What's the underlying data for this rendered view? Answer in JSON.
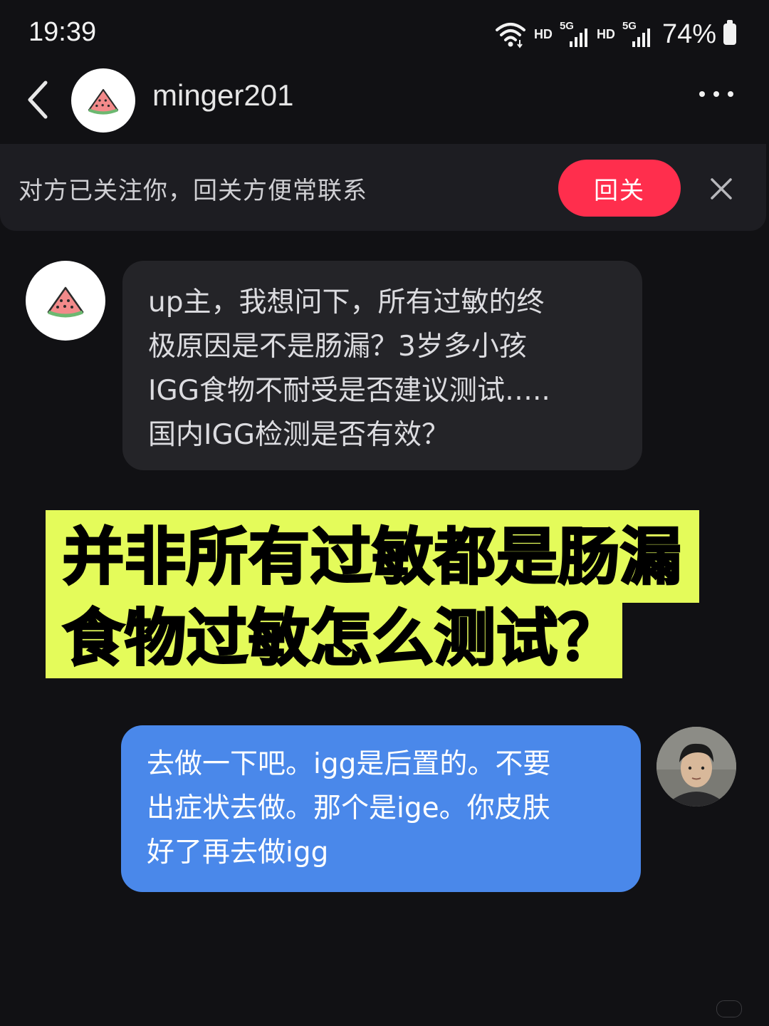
{
  "status_bar": {
    "time": "19:39",
    "network_1": "HD",
    "network_2": "HD",
    "signal_label": "5G",
    "battery": "74%"
  },
  "header": {
    "contact_name": "minger201",
    "back_icon": "chevron-left-icon",
    "more_icon": "more-horizontal-icon"
  },
  "follow_banner": {
    "text": "对方已关注你，回关方便常联系",
    "button_label": "回关",
    "close_icon": "close-icon"
  },
  "messages": [
    {
      "direction": "incoming",
      "lines": [
        "up主，我想问下，所有过敏的终",
        "极原因是不是肠漏？3岁多小孩",
        "IGG食物不耐受是否建议测试…..",
        "国内IGG检测是否有效？"
      ]
    },
    {
      "direction": "outgoing",
      "lines": [
        "去做一下吧。igg是后置的。不要",
        "出症状去做。那个是ige。你皮肤",
        "好了再去做igg"
      ]
    }
  ],
  "overlay_title": {
    "line1": "并非所有过敏都是肠漏",
    "line2": "食物过敏怎么测试？"
  },
  "colors": {
    "background": "#111114",
    "follow_button": "#ff2e4d",
    "incoming_bubble": "#242428",
    "outgoing_bubble": "#4a88ea",
    "title_highlight": "#e4fb5a"
  }
}
